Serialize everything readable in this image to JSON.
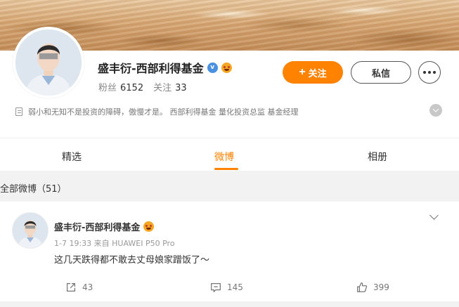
{
  "profile": {
    "name": "盛丰衍-西部利得基金",
    "verified_icon": "verified-v-icon",
    "fans_label": "粉丝",
    "fans_count": "6152",
    "follow_label": "关注",
    "follow_count": "33",
    "follow_button": "关注",
    "message_button": "私信",
    "bio": "弱小和无知不是投资的障碍，傲慢才是。 西部利得基金 量化投资总监 基金经理"
  },
  "tabs": [
    {
      "label": "精选",
      "active": false
    },
    {
      "label": "微博",
      "active": true
    },
    {
      "label": "相册",
      "active": false
    }
  ],
  "section": {
    "title": "全部微博（51）"
  },
  "post": {
    "author": "盛丰衍-西部利得基金",
    "meta": "1-7 19:33  来自 HUAWEI P50 Pro",
    "text": "这几天跌得都不敢去丈母娘家蹭饭了～",
    "reposts": "43",
    "comments": "145",
    "likes": "399"
  },
  "colors": {
    "accent": "#ff8200",
    "verified": "#4a90e2"
  }
}
